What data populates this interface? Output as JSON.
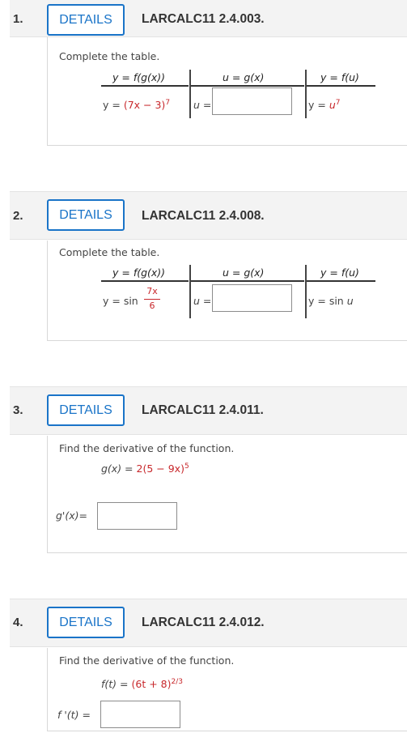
{
  "details_label": "DETAILS",
  "q1": {
    "number": "1.",
    "ref": "LARCALC11 2.4.003.",
    "instruction": "Complete the table.",
    "col1_header": "y = f(g(x))",
    "col2_header": "u = g(x)",
    "col3_header": "y = f(u)",
    "row_y_prefix": "y = ",
    "row_y_expr": "(7x − 3)",
    "row_y_exp": "7",
    "u_label": "u =",
    "yu_prefix": "y = ",
    "yu_base": "u",
    "yu_exp": "7"
  },
  "q2": {
    "number": "2.",
    "ref": "LARCALC11 2.4.008.",
    "instruction": "Complete the table.",
    "col1_header": "y = f(g(x))",
    "col2_header": "u = g(x)",
    "col3_header": "y = f(u)",
    "row_y_prefix": "y = sin",
    "frac_num": "7x",
    "frac_den": "6",
    "u_label": "u =",
    "yu_text": "y = sin ",
    "yu_var": "u"
  },
  "q3": {
    "number": "3.",
    "ref": "LARCALC11 2.4.011.",
    "instruction": "Find the derivative of the function.",
    "func_lhs": "g(x) = ",
    "func_rhs": "2(5 − 9x)",
    "func_exp": "5",
    "answer_label": "g'(x)="
  },
  "q4": {
    "number": "4.",
    "ref": "LARCALC11 2.4.012.",
    "instruction": "Find the derivative of the function.",
    "func_lhs": "f(t) = ",
    "func_rhs": "(6t + 8)",
    "func_exp": "2/3",
    "answer_label": "f '(t) ="
  }
}
